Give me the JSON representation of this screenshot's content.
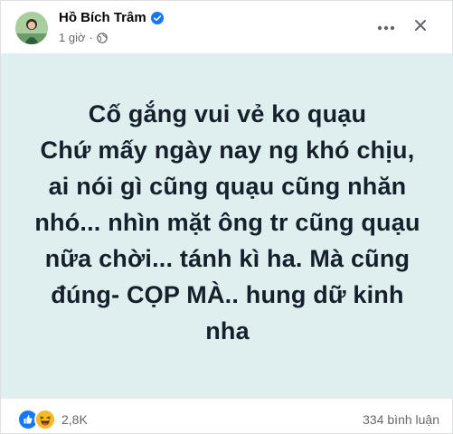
{
  "post": {
    "author_name": "Hồ Bích Trâm",
    "time_ago": "1 giờ",
    "separator": "·",
    "status_text": "Cố gắng vui vẻ ko quạu\nChứ mấy ngày nay ng khó chịu, ai nói gì cũng quạu cũng nhăn nhó... nhìn mặt ông tr cũng quạu nữa chời... tánh kì ha. Mà cũng đúng- CỌP MÀ.. hung dữ kinh nha",
    "background_color": "#dfeeee"
  },
  "icons": {
    "verified": "verified-badge-icon",
    "privacy": "globe-icon",
    "more": "more-horizontal-icon",
    "close": "close-icon",
    "reaction_like": "like-reaction-icon",
    "reaction_haha": "haha-reaction-icon"
  },
  "footer": {
    "reaction_count": "2,8K",
    "comment_count": "334 bình luận"
  },
  "colors": {
    "verified_blue": "#1877f2",
    "secondary_text": "#65676b",
    "haha_yellow": "#f7b928"
  }
}
